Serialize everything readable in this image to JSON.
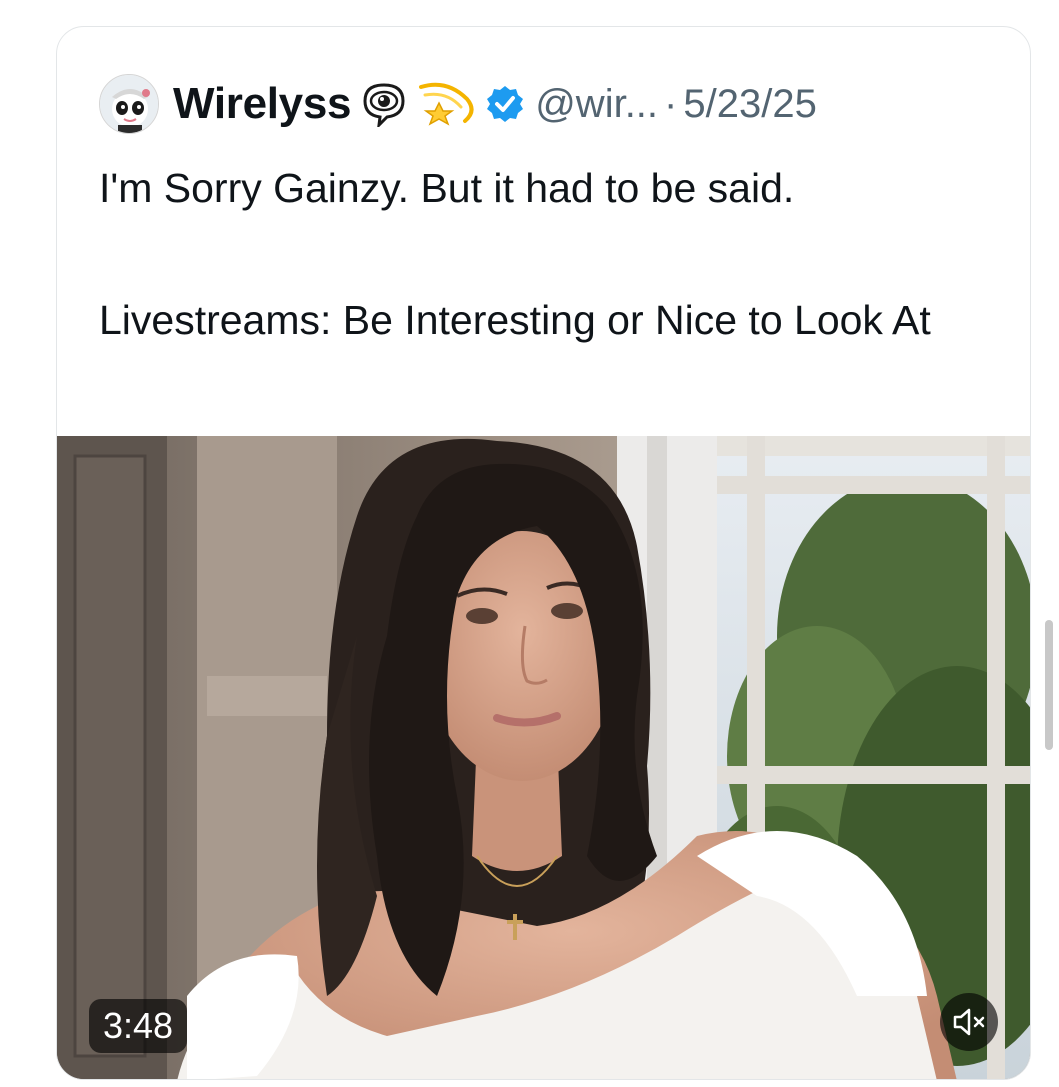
{
  "tweet": {
    "author_name": "Wirelyss",
    "handle": "@wir...",
    "separator": "·",
    "date": "5/23/25",
    "verified": true,
    "name_emojis": [
      "eye-in-speech-bubble-icon",
      "dizzy-star-icon"
    ],
    "text_line1": "I'm Sorry Gainzy. But it had to be said.",
    "text_line2": "Livestreams: Be Interesting or Nice to Look At"
  },
  "video": {
    "duration": "3:48",
    "muted": true
  },
  "colors": {
    "text_primary": "#0f1419",
    "text_secondary": "#536471",
    "verified_blue": "#1d9bf0",
    "card_border": "#e3e6e8"
  }
}
